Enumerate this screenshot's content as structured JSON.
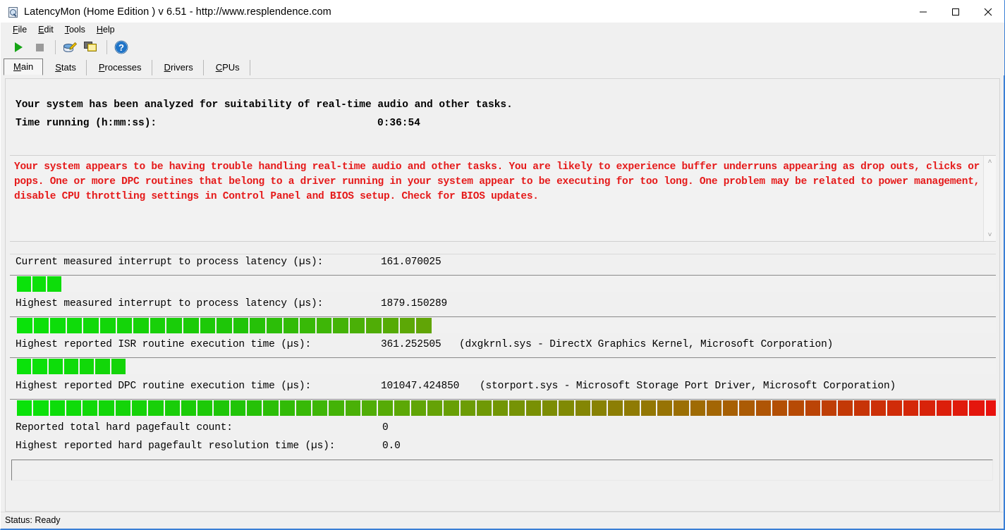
{
  "window": {
    "title": "LatencyMon  (Home Edition )  v 6.51 - http://www.resplendence.com",
    "icon": "latencymon-app-icon",
    "minimize_label": "Minimize",
    "maximize_label": "Maximize",
    "close_label": "Close"
  },
  "menu": {
    "items": [
      {
        "label": "File",
        "accel": "F"
      },
      {
        "label": "Edit",
        "accel": "E"
      },
      {
        "label": "Tools",
        "accel": "T"
      },
      {
        "label": "Help",
        "accel": "H"
      }
    ]
  },
  "toolbar": {
    "buttons": [
      {
        "name": "start-monitoring-button",
        "icon": "play-icon",
        "enabled": true
      },
      {
        "name": "stop-monitoring-button",
        "icon": "stop-icon",
        "enabled": false
      },
      {
        "name": "report-button",
        "icon": "disk-pencil-icon",
        "enabled": true
      },
      {
        "name": "copy-windows-button",
        "icon": "copy-windows-icon",
        "enabled": true
      },
      {
        "name": "help-button",
        "icon": "help-circle-icon",
        "enabled": true
      }
    ]
  },
  "tabs": [
    {
      "label": "Main",
      "accel": "M",
      "selected": true
    },
    {
      "label": "Stats",
      "accel": "S",
      "selected": false
    },
    {
      "label": "Processes",
      "accel": "P",
      "selected": false
    },
    {
      "label": "Drivers",
      "accel": "D",
      "selected": false
    },
    {
      "label": "CPUs",
      "accel": "C",
      "selected": false
    }
  ],
  "main": {
    "headline": "Your system has been analyzed for suitability of real-time audio and other tasks.",
    "time_running_label": "Time running (h:mm:ss):",
    "time_running_value": "0:36:54",
    "warning_color": "#e51a1a",
    "warning_text": "Your system appears to be having trouble handling real-time audio and other tasks. You are likely to experience buffer underruns appearing as drop outs, clicks or pops. One or more DPC routines that belong to a driver running in your system appear to be executing for too long. One problem may be related to power management, disable CPU throttling settings in Control Panel and BIOS setup. Check for BIOS updates.",
    "metrics": [
      {
        "label": "Current measured interrupt to process latency (µs):",
        "value": "161.070025",
        "extra": "",
        "gauge_segments": 3,
        "gauge_width": 63
      },
      {
        "label": "Highest measured interrupt to process latency (µs):",
        "value": "1879.150289",
        "extra": "",
        "gauge_segments": 25,
        "gauge_width": 588
      },
      {
        "label": "Highest reported ISR routine execution time (µs):",
        "value": "361.252505",
        "extra": "(dxgkrnl.sys - DirectX Graphics Kernel, Microsoft Corporation)",
        "gauge_segments": 7,
        "gauge_width": 154
      },
      {
        "label": "Highest reported DPC routine execution time (µs):",
        "value": "101047.424850",
        "extra": "(storport.sys - Microsoft Storage Port Driver, Microsoft Corporation)",
        "gauge_segments": 60,
        "gauge_width": 1395
      }
    ],
    "footer_rows": [
      {
        "label": "Reported total hard pagefault count:",
        "value": "0"
      },
      {
        "label": "Highest reported hard pagefault resolution time (µs):",
        "value": "0.0"
      }
    ]
  },
  "statusbar": {
    "text": "Status: Ready"
  },
  "scrollbar": {
    "up_arrow": "˄",
    "down_arrow": "˅"
  }
}
